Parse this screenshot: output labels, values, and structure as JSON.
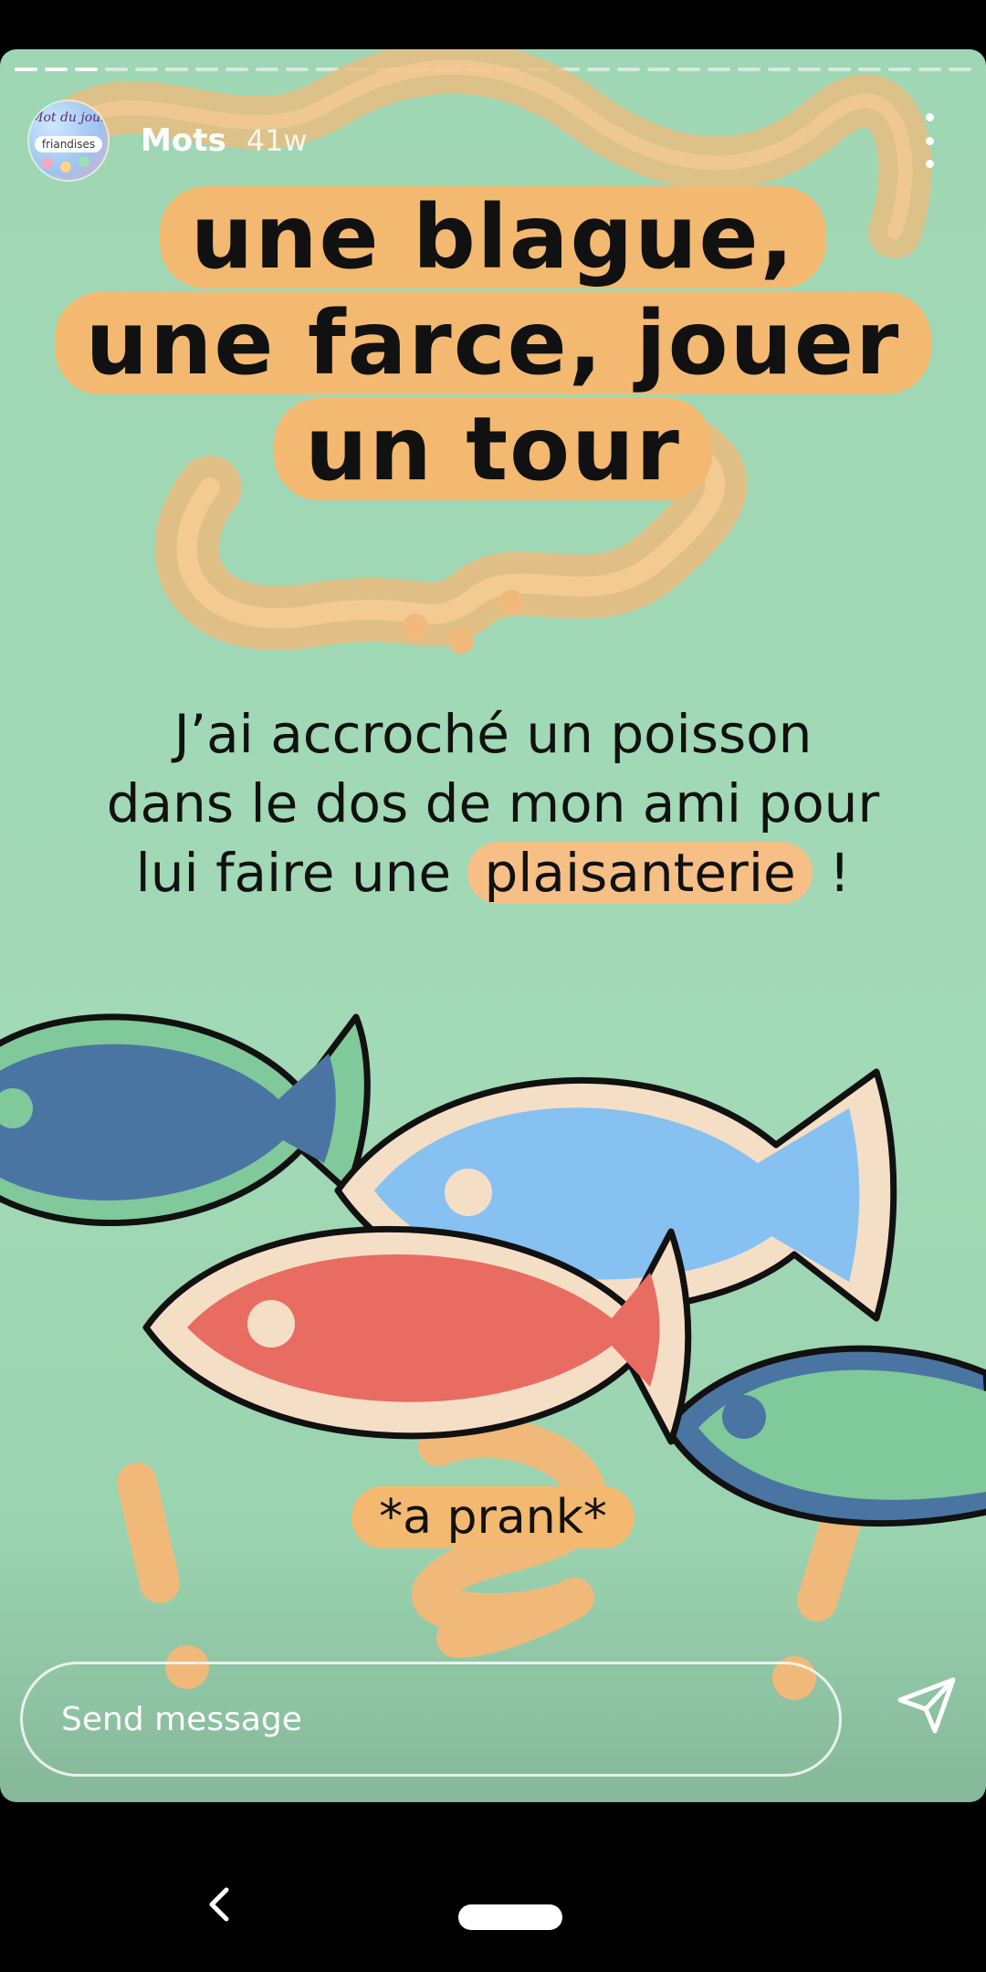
{
  "story": {
    "username": "Mots",
    "time_ago": "41w",
    "avatar": {
      "script_text": "Mot du jour",
      "banner_text": "friandises"
    }
  },
  "content": {
    "title_lines": [
      "une blague,",
      "une farce, jouer",
      "un tour"
    ],
    "body": {
      "line1": "J’ai accroché un poisson",
      "line2": "dans le dos de mon ami pour",
      "line3_before": "lui faire une ",
      "line3_highlight": "plaisanterie",
      "line3_after": " !"
    },
    "translation": "*a prank*"
  },
  "composer": {
    "placeholder": "Send message"
  },
  "colors": {
    "background": "#a2d9b6",
    "highlight": "#f3b970",
    "fish_red": "#e96c63",
    "fish_light_blue": "#86c1f1",
    "fish_dark_blue": "#4a75a2",
    "fish_green": "#80c99a",
    "fish_outline_cream": "#f4dfc6"
  },
  "icons": {
    "more": "vertical-dots-icon",
    "send": "paper-plane-icon",
    "back": "chevron-left-icon",
    "home": "home-pill-icon"
  }
}
